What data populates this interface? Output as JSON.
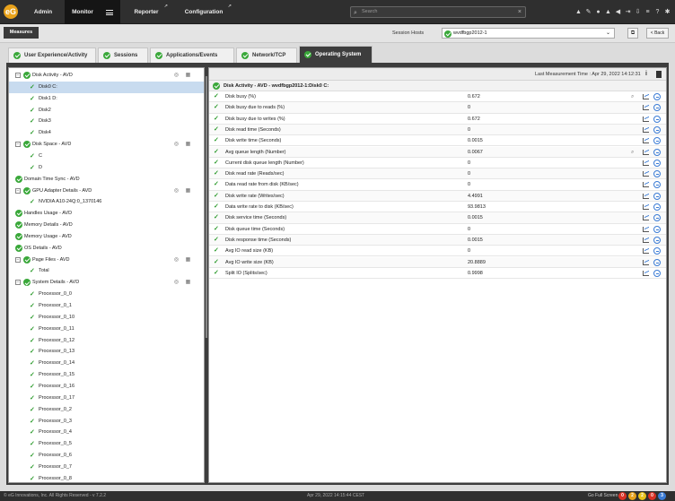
{
  "app": {
    "logo": "eG"
  },
  "nav": {
    "items": [
      {
        "label": "Admin"
      },
      {
        "label": "Monitor"
      },
      {
        "label": "Reporter"
      },
      {
        "label": "Configuration"
      }
    ]
  },
  "search": {
    "placeholder": "Search"
  },
  "header_icons": [
    "bell-icon",
    "pin-icon",
    "user-icon",
    "alert-icon",
    "sound-icon",
    "logout-icon",
    "download-icon",
    "list-icon",
    "help-icon",
    "settings-icon"
  ],
  "subbar": {
    "measures_label": "Measures",
    "session_hosts_label": "Session Hosts",
    "session_host_value": "wvdfbgp2012-1",
    "back_label": "< Back"
  },
  "tabs": [
    {
      "label": "User Experience/Activity"
    },
    {
      "label": "Sessions"
    },
    {
      "label": "Applications/Events"
    },
    {
      "label": "Network/TCP"
    },
    {
      "label": "Operating System",
      "active": true
    }
  ],
  "tree": [
    {
      "label": "Disk Activity - AVD",
      "level": 0,
      "expandable": true,
      "icons": true
    },
    {
      "label": "Disk0 C:",
      "level": 1,
      "selected": true
    },
    {
      "label": "Disk1 D:",
      "level": 1
    },
    {
      "label": "Disk2",
      "level": 1
    },
    {
      "label": "Disk3",
      "level": 1
    },
    {
      "label": "Disk4",
      "level": 1
    },
    {
      "label": "Disk Space - AVD",
      "level": 0,
      "expandable": true,
      "icons": true
    },
    {
      "label": "C",
      "level": 1
    },
    {
      "label": "D",
      "level": 1
    },
    {
      "label": "Domain Time Sync - AVD",
      "level": 0
    },
    {
      "label": "GPU Adapter Details - AVD",
      "level": 0,
      "expandable": true,
      "icons": true
    },
    {
      "label": "NVIDIA A10-24Q:0_1370146",
      "level": 1
    },
    {
      "label": "Handles Usage - AVD",
      "level": 0
    },
    {
      "label": "Memory Details - AVD",
      "level": 0
    },
    {
      "label": "Memory Usage - AVD",
      "level": 0
    },
    {
      "label": "OS Details - AVD",
      "level": 0
    },
    {
      "label": "Page Files - AVD",
      "level": 0,
      "expandable": true,
      "icons": true
    },
    {
      "label": "Total",
      "level": 1
    },
    {
      "label": "System Details - AVD",
      "level": 0,
      "expandable": true,
      "icons": true
    },
    {
      "label": "Processor_0_0",
      "level": 1
    },
    {
      "label": "Processor_0_1",
      "level": 1
    },
    {
      "label": "Processor_0_10",
      "level": 1
    },
    {
      "label": "Processor_0_11",
      "level": 1
    },
    {
      "label": "Processor_0_12",
      "level": 1
    },
    {
      "label": "Processor_0_13",
      "level": 1
    },
    {
      "label": "Processor_0_14",
      "level": 1
    },
    {
      "label": "Processor_0_15",
      "level": 1
    },
    {
      "label": "Processor_0_16",
      "level": 1
    },
    {
      "label": "Processor_0_17",
      "level": 1
    },
    {
      "label": "Processor_0_2",
      "level": 1
    },
    {
      "label": "Processor_0_3",
      "level": 1
    },
    {
      "label": "Processor_0_4",
      "level": 1
    },
    {
      "label": "Processor_0_5",
      "level": 1
    },
    {
      "label": "Processor_0_6",
      "level": 1
    },
    {
      "label": "Processor_0_7",
      "level": 1
    },
    {
      "label": "Processor_0_8",
      "level": 1
    }
  ],
  "panel": {
    "last_measurement": "Last Measurement Time : Apr 29, 2022 14:12:31",
    "header": "Disk Activity - AVD - wvdfbgp2012-1:Disk0 C:",
    "measures": [
      {
        "name": "Disk busy (%)",
        "value": "0.672",
        "zoom": true
      },
      {
        "name": "Disk busy due to reads (%)",
        "value": "0"
      },
      {
        "name": "Disk busy due to writes (%)",
        "value": "0.672"
      },
      {
        "name": "Disk read time (Seconds)",
        "value": "0"
      },
      {
        "name": "Disk write time (Seconds)",
        "value": "0.0015"
      },
      {
        "name": "Avg queue length (Number)",
        "value": "0.0067",
        "zoom": true
      },
      {
        "name": "Current disk queue length (Number)",
        "value": "0"
      },
      {
        "name": "Disk read rate (Reads/sec)",
        "value": "0"
      },
      {
        "name": "Data read rate from disk (KB/sec)",
        "value": "0"
      },
      {
        "name": "Disk write rate (Writes/sec)",
        "value": "4.4991"
      },
      {
        "name": "Data write rate to disk (KB/sec)",
        "value": "93.9813"
      },
      {
        "name": "Disk service time (Seconds)",
        "value": "0.0015"
      },
      {
        "name": "Disk queue time (Seconds)",
        "value": "0"
      },
      {
        "name": "Disk response time (Seconds)",
        "value": "0.0015"
      },
      {
        "name": "Avg IO read size (KB)",
        "value": "0"
      },
      {
        "name": "Avg IO write size (KB)",
        "value": "20.8889"
      },
      {
        "name": "Split IO (Splits/sec)",
        "value": "0.9998"
      }
    ]
  },
  "footer": {
    "copyright": "© eG Innovations, Inc. All Rights Reserved - v 7.2.2",
    "datetime": "Apr 29, 2022 14:15:44 CEST",
    "fullscreen": "Go Full Screen",
    "badges": [
      {
        "text": "0",
        "color": "#d93025"
      },
      {
        "text": "2",
        "color": "#e8a21b"
      },
      {
        "text": "2",
        "color": "#e8c21b"
      },
      {
        "text": "0",
        "color": "#d93025"
      },
      {
        "text": "3",
        "color": "#3a7bd5"
      }
    ]
  }
}
